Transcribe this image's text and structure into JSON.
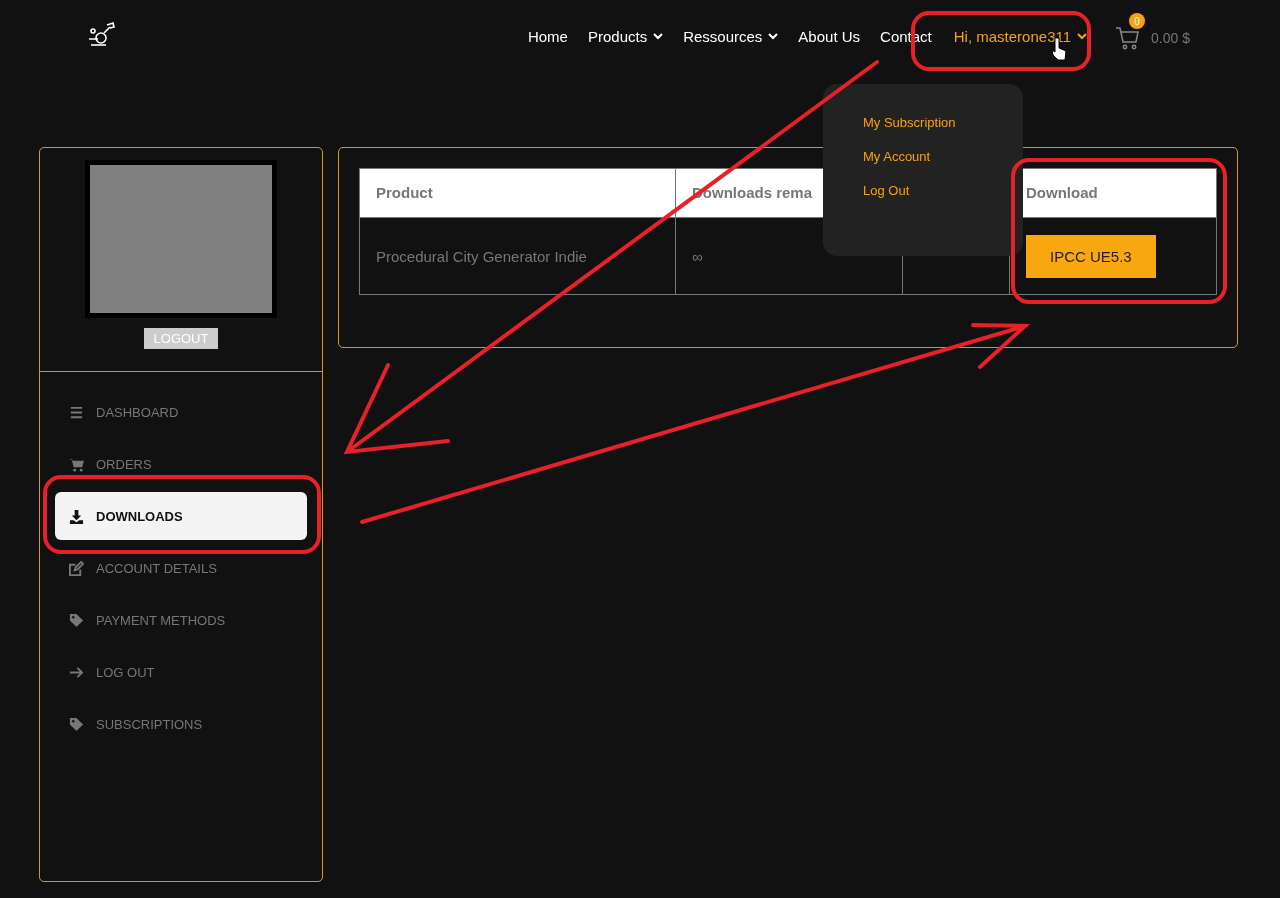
{
  "nav": {
    "items": [
      {
        "label": "Home",
        "kind": "link"
      },
      {
        "label": "Products",
        "kind": "dropdown"
      },
      {
        "label": "Ressources",
        "kind": "dropdown"
      },
      {
        "label": "About Us",
        "kind": "link"
      },
      {
        "label": "Contact",
        "kind": "link"
      }
    ],
    "user": {
      "label": "Hi, masterone311",
      "expanded": true
    },
    "cart": {
      "count": "0",
      "total": "0.00 $"
    }
  },
  "user_menu": [
    "My Subscription",
    "My Account",
    "Log Out"
  ],
  "sidebar": {
    "logout": "LOGOUT",
    "items": [
      {
        "label": "DASHBOARD",
        "kind": "menu",
        "selected": false
      },
      {
        "label": "ORDERS",
        "kind": "cart",
        "selected": false
      },
      {
        "label": "DOWNLOADS",
        "kind": "download",
        "selected": true
      },
      {
        "label": "ACCOUNT DETAILS",
        "kind": "edit",
        "selected": false
      },
      {
        "label": "PAYMENT METHODS",
        "kind": "tag",
        "selected": false
      },
      {
        "label": "LOG OUT",
        "kind": "arrow",
        "selected": false
      },
      {
        "label": "SUBSCRIPTIONS",
        "kind": "tag",
        "selected": false
      }
    ]
  },
  "table": {
    "columns": [
      "Product",
      "Downloads rema",
      "Download"
    ],
    "rows": [
      {
        "product": "Procedural City Generator Indie",
        "remaining": "∞",
        "button": "IPCC UE5.3"
      }
    ]
  }
}
